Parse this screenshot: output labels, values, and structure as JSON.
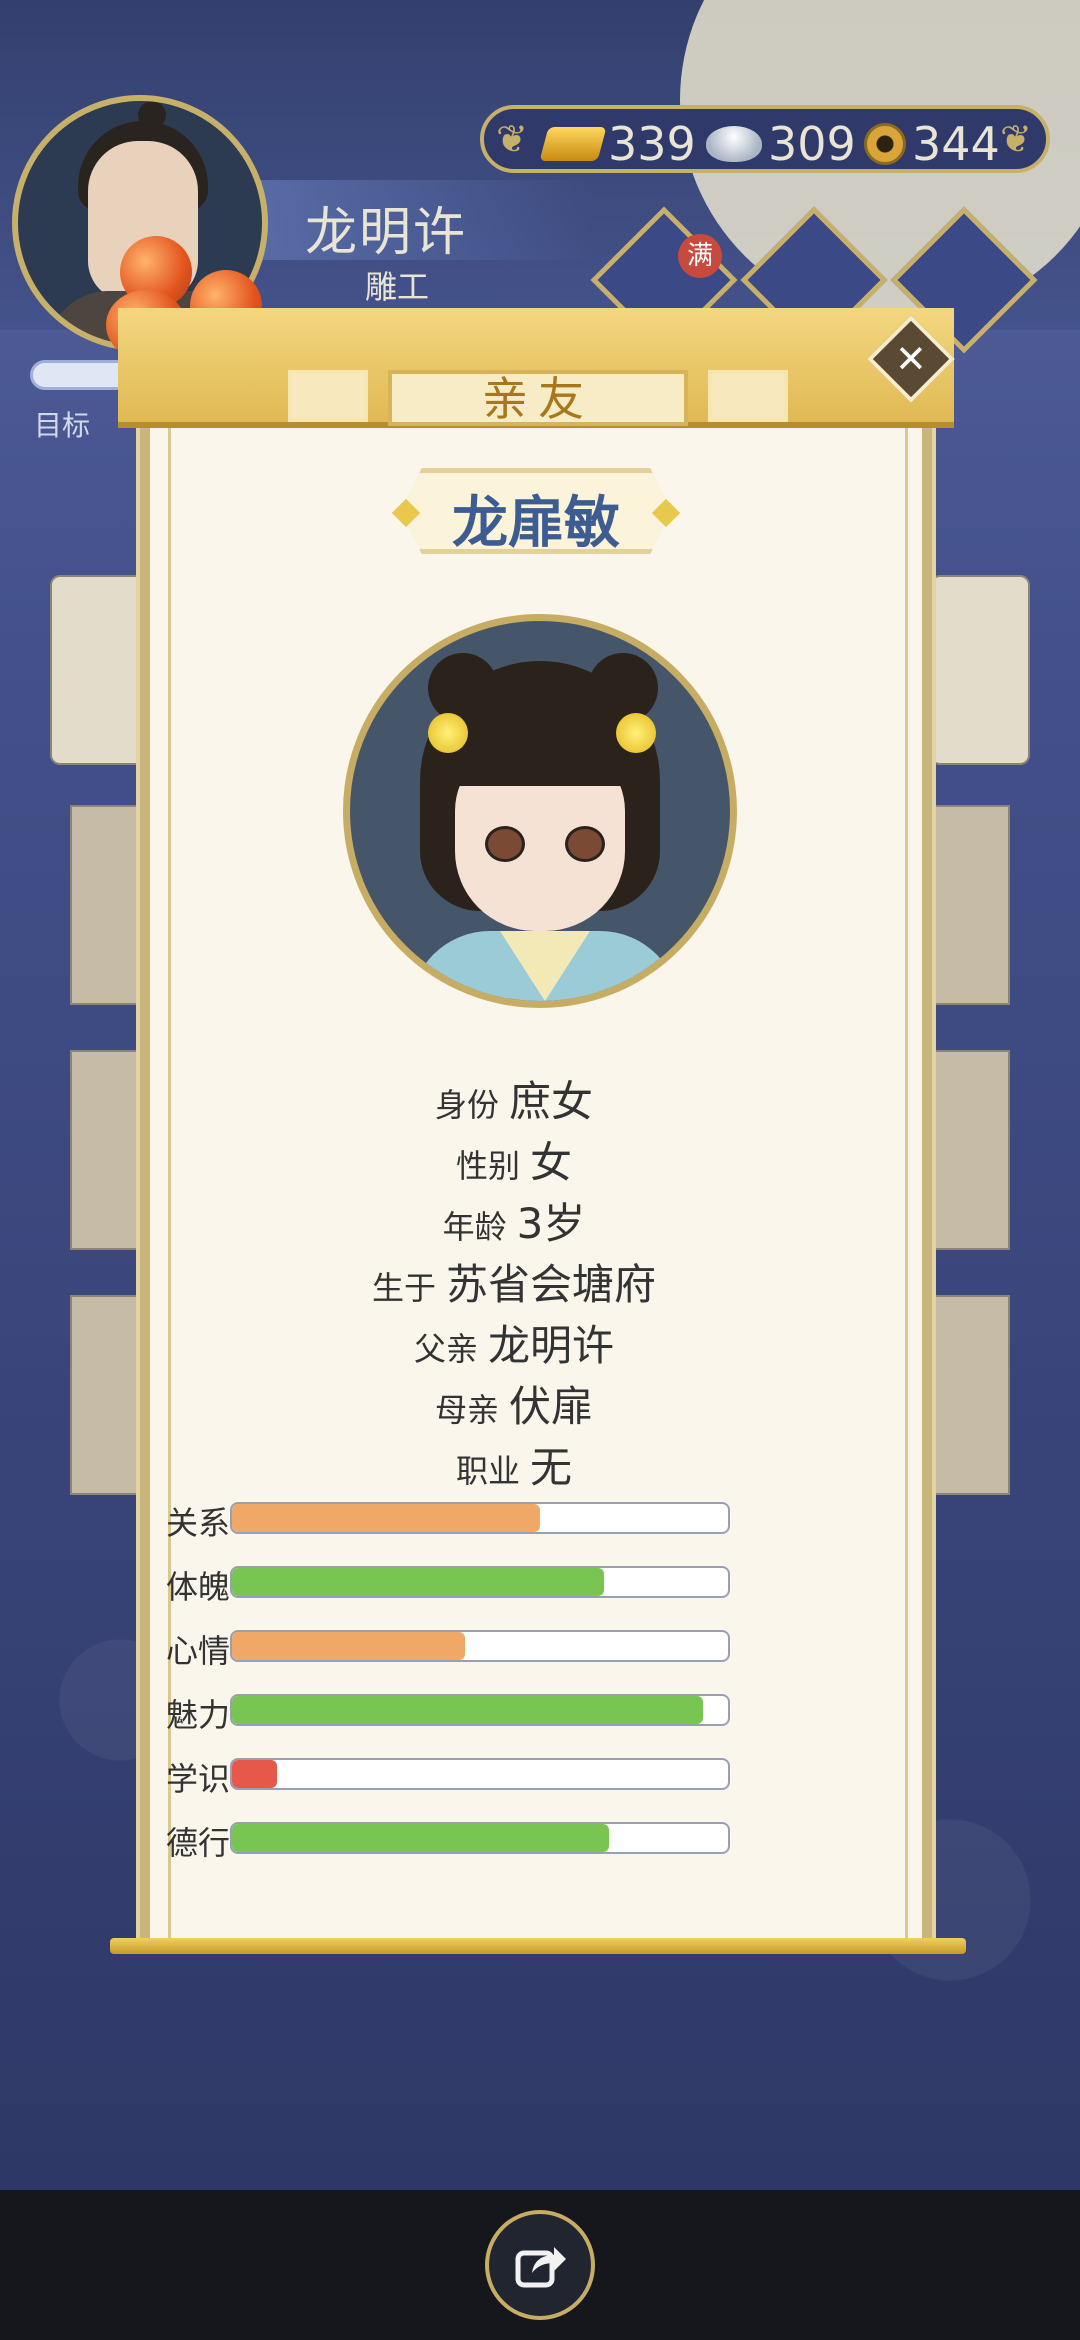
{
  "header": {
    "player_name": "龙明许",
    "player_job": "雕工",
    "goal_label": "目标",
    "badge_full": "满"
  },
  "resources": {
    "gold": "339",
    "silver": "309",
    "coins": "344"
  },
  "popup": {
    "title": "亲友",
    "close_label": "✕",
    "character_name": "龙扉敏",
    "info": [
      {
        "key": "身份",
        "value": "庶女"
      },
      {
        "key": "性别",
        "value": "女"
      },
      {
        "key": "年龄",
        "value": "3岁"
      },
      {
        "key": "生于",
        "value": "苏省会塘府"
      },
      {
        "key": "父亲",
        "value": "龙明许"
      },
      {
        "key": "母亲",
        "value": "伏扉"
      },
      {
        "key": "职业",
        "value": "无"
      }
    ],
    "stats": [
      {
        "label": "关系",
        "level": 0.62,
        "color": "#efa866"
      },
      {
        "label": "体魄",
        "level": 0.75,
        "color": "#78c552"
      },
      {
        "label": "心情",
        "level": 0.47,
        "color": "#efa866"
      },
      {
        "label": "魅力",
        "level": 0.95,
        "color": "#78c552"
      },
      {
        "label": "学识",
        "level": 0.09,
        "color": "#e6584a"
      },
      {
        "label": "德行",
        "level": 0.76,
        "color": "#78c552"
      }
    ]
  },
  "icons": {
    "gold": "gold-ingot-icon",
    "silver": "silver-ingot-icon",
    "coin": "copper-coin-icon",
    "share": "share-icon",
    "close": "close-icon"
  }
}
